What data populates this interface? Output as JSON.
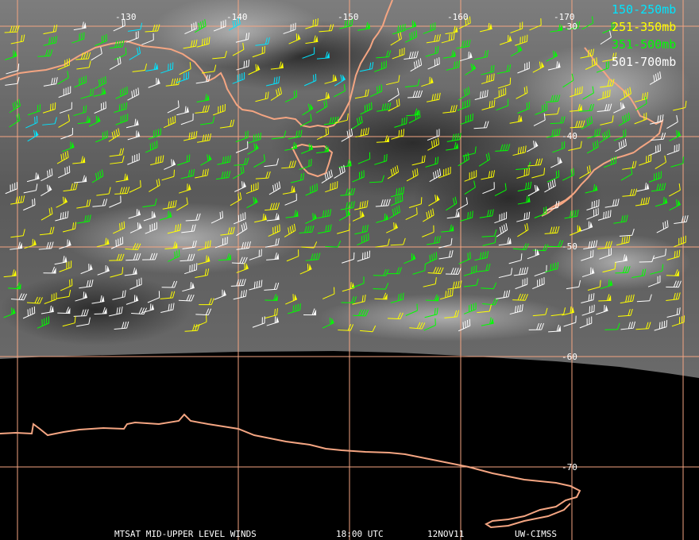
{
  "map": {
    "longitude_labels": [
      "-130",
      "-140",
      "-150",
      "-160",
      "-170"
    ],
    "latitude_labels": [
      "-30",
      "-40",
      "-50",
      "-60",
      "-70"
    ]
  },
  "legend": {
    "items": [
      {
        "label": "150-250mb",
        "color": "#00e5ff"
      },
      {
        "label": "251-350mb",
        "color": "#ffff00"
      },
      {
        "label": "351-500mb",
        "color": "#00ff00"
      },
      {
        "label": "501-700mb",
        "color": "#ffffff"
      }
    ]
  },
  "footer": {
    "product": "MTSAT MID-UPPER LEVEL WINDS",
    "time": "18:00 UTC",
    "date": "12NOV11",
    "source": "UW-CIMSS"
  },
  "colors": {
    "grid": "#f4a582",
    "coast": "#f4a582",
    "background": "#000000"
  }
}
